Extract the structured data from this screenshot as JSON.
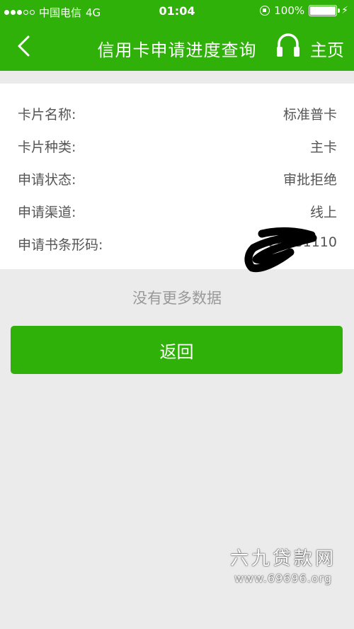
{
  "status_bar": {
    "carrier": "中国电信",
    "network": "4G",
    "time": "01:04",
    "battery": "100%"
  },
  "nav": {
    "title": "信用卡申请进度查询",
    "home": "主页"
  },
  "details": [
    {
      "label": "卡片名称:",
      "value": "标准普卡"
    },
    {
      "label": "卡片种类:",
      "value": "主卡"
    },
    {
      "label": "申请状态:",
      "value": "审批拒绝"
    },
    {
      "label": "申请渠道:",
      "value": "线上"
    },
    {
      "label": "申请书条形码:",
      "value": "20181110"
    }
  ],
  "no_more_text": "没有更多数据",
  "return_label": "返回",
  "watermark": {
    "name": "六九贷款网",
    "url": "www.69696.org"
  },
  "colors": {
    "brand_green": "#2fb10a",
    "background": "#ebebeb"
  }
}
